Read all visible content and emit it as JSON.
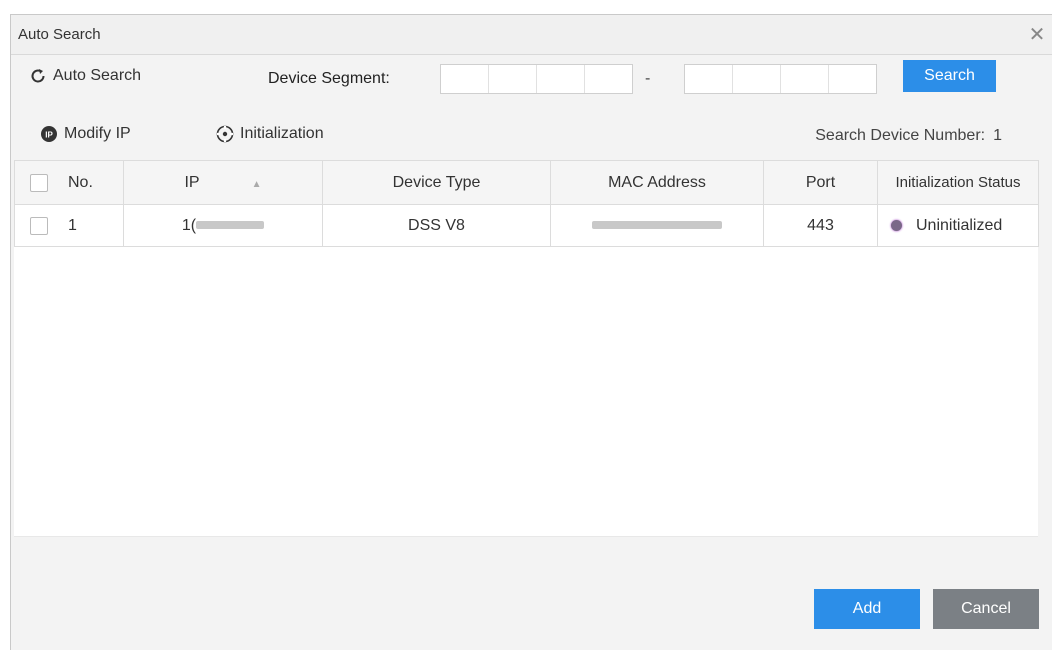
{
  "dialog": {
    "title": "Auto Search",
    "close_icon": "close-icon"
  },
  "toolbar": {
    "auto_search_label": "Auto Search",
    "device_segment_label": "Device Segment:",
    "segment_separator": "-",
    "search_label": "Search",
    "modify_ip_label": "Modify IP",
    "initialization_label": "Initialization",
    "device_count_label": "Search Device Number:",
    "device_count": "1"
  },
  "table": {
    "headers": [
      "No.",
      "IP",
      "Device Type",
      "MAC Address",
      "Port",
      "Initialization Status"
    ],
    "rows": [
      {
        "no": "1",
        "ip_prefix": "1(",
        "device_type": "DSS V8",
        "port": "443",
        "status": "Uninitialized",
        "status_color": "#7a6888"
      }
    ]
  },
  "footer": {
    "add_label": "Add",
    "cancel_label": "Cancel"
  },
  "colors": {
    "primary": "#2c8ee8",
    "secondary": "#7b8085"
  }
}
